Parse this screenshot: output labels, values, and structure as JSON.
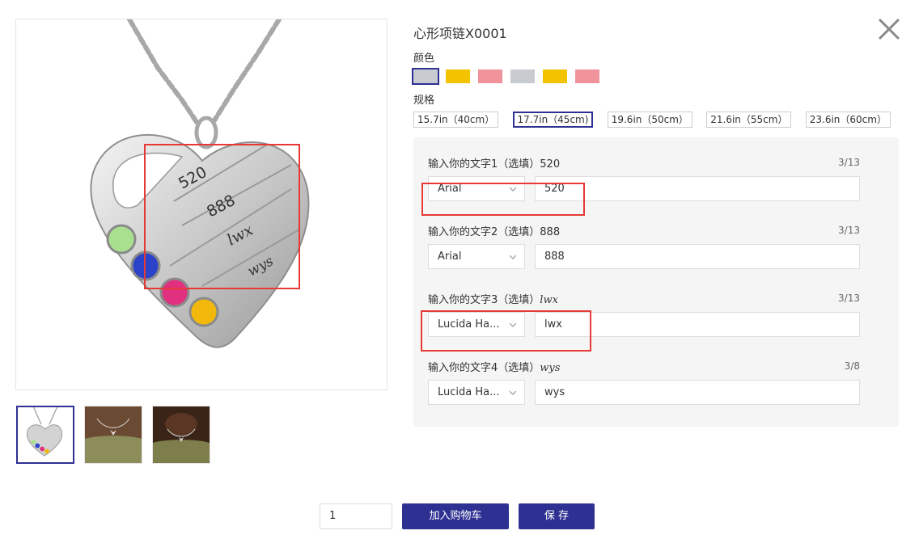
{
  "product": {
    "title": "心形项链X0001"
  },
  "colors": {
    "label": "颜色",
    "swatches": [
      {
        "color": "#c8cbd0",
        "selected": true
      },
      {
        "color": "#f4c300",
        "selected": false
      },
      {
        "color": "#f0939b",
        "selected": false
      },
      {
        "color": "#c8cbd0",
        "selected": false
      },
      {
        "color": "#f4c300",
        "selected": false
      },
      {
        "color": "#f0939b",
        "selected": false
      }
    ]
  },
  "sizes": {
    "label": "规格",
    "options": [
      {
        "label": "15.7in（40cm）",
        "selected": false
      },
      {
        "label": "17.7in（45cm)",
        "selected": true
      },
      {
        "label": "19.6in（50cm）",
        "selected": false
      },
      {
        "label": "21.6in（55cm）",
        "selected": false
      },
      {
        "label": "23.6in（60cm）",
        "selected": false
      }
    ]
  },
  "fields": [
    {
      "label": "输入你的文字1（选填）",
      "preview": "520",
      "count": "3/13",
      "font": "Arial",
      "value": "520"
    },
    {
      "label": "输入你的文字2（选填）",
      "preview": "888",
      "count": "3/13",
      "font": "Arial",
      "value": "888"
    },
    {
      "label": "输入你的文字3（选填）",
      "preview": "lwx",
      "count": "3/13",
      "font": "Lucida Ha...",
      "value": "lwx"
    },
    {
      "label": "输入你的文字4（选填）",
      "preview": "wys",
      "count": "3/8",
      "font": "Lucida Ha...",
      "value": "wys"
    }
  ],
  "engraving": [
    "520",
    "888",
    "lwx",
    "wys"
  ],
  "actions": {
    "quantity": "1",
    "add_to_cart": "加入购物车",
    "save": "保 存"
  },
  "accent_color": "#2e3192",
  "highlight_color": "#e53935",
  "icons": [
    "close-icon",
    "chevron-down-icon"
  ]
}
